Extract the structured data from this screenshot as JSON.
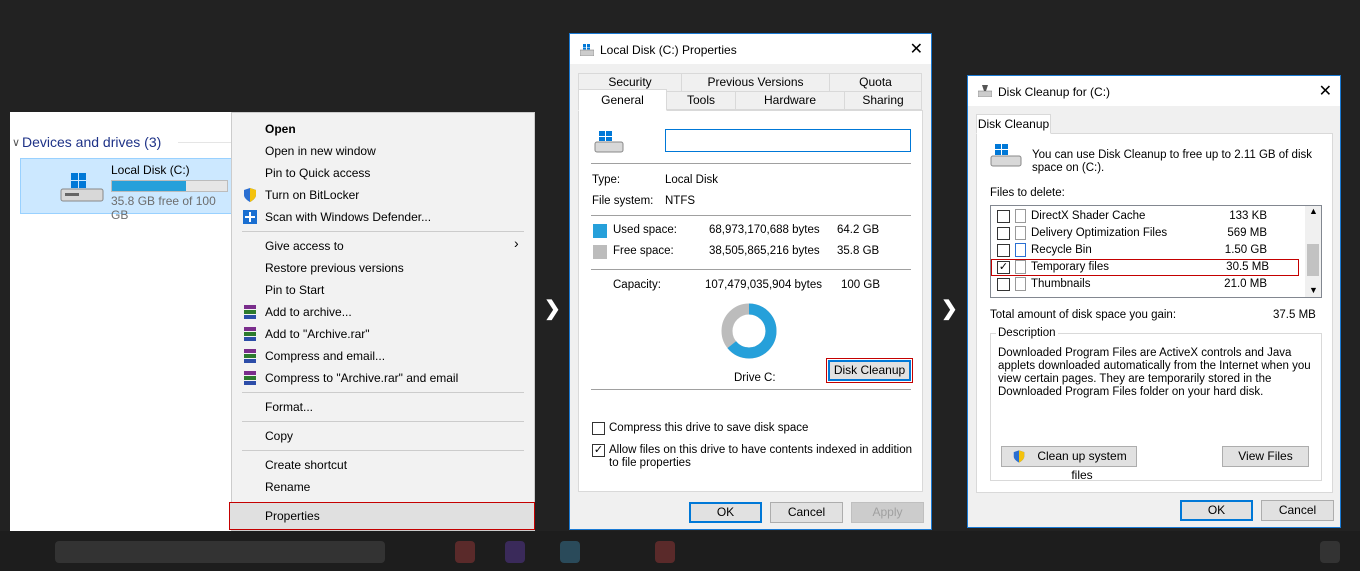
{
  "explorer": {
    "section_title": "Devices and drives (3)",
    "drive_name": "Local Disk (C:)",
    "drive_free": "35.8 GB free of 100 GB",
    "drive_used_fraction": 0.64
  },
  "context_menu": {
    "items": [
      "Open",
      "Open in new window",
      "Pin to Quick access",
      "Turn on BitLocker",
      "Scan with Windows Defender...",
      "Give access to",
      "Restore previous versions",
      "Pin to Start",
      "Add to archive...",
      "Add to \"Archive.rar\"",
      "Compress and email...",
      "Compress to \"Archive.rar\" and email",
      "Format...",
      "Copy",
      "Create shortcut",
      "Rename",
      "Properties"
    ]
  },
  "properties": {
    "title": "Local Disk (C:) Properties",
    "tabs_row1": [
      "Security",
      "Previous Versions",
      "Quota"
    ],
    "tabs_row2": [
      "General",
      "Tools",
      "Hardware",
      "Sharing"
    ],
    "name_value": "",
    "type_label": "Type:",
    "type_value": "Local Disk",
    "fs_label": "File system:",
    "fs_value": "NTFS",
    "used_label": "Used space:",
    "used_bytes": "68,973,170,688 bytes",
    "used_gb": "64.2 GB",
    "free_label": "Free space:",
    "free_bytes": "38,505,865,216 bytes",
    "free_gb": "35.8 GB",
    "capacity_label": "Capacity:",
    "capacity_bytes": "107,479,035,904 bytes",
    "capacity_gb": "100 GB",
    "used_fraction": 0.642,
    "drive_label": "Drive C:",
    "disk_cleanup_btn": "Disk Cleanup",
    "compress_label": "Compress this drive to save disk space",
    "index_label": "Allow files on this drive to have contents indexed in addition to file properties",
    "ok": "OK",
    "cancel": "Cancel",
    "apply": "Apply",
    "colors": {
      "used": "#26a0da",
      "free": "#bcbcbc"
    }
  },
  "cleanup": {
    "title": "Disk Cleanup for  (C:)",
    "tab": "Disk Cleanup",
    "intro": "You can use Disk Cleanup to free up to 2.11 GB of disk space on  (C:).",
    "files_label": "Files to delete:",
    "files": [
      {
        "name": "DirectX Shader Cache",
        "size": "133 KB",
        "checked": false
      },
      {
        "name": "Delivery Optimization Files",
        "size": "569 MB",
        "checked": false
      },
      {
        "name": "Recycle Bin",
        "size": "1.50 GB",
        "checked": false
      },
      {
        "name": "Temporary files",
        "size": "30.5 MB",
        "checked": true
      },
      {
        "name": "Thumbnails",
        "size": "21.0 MB",
        "checked": false
      }
    ],
    "total_label": "Total amount of disk space you gain:",
    "total_value": "37.5 MB",
    "desc_label": "Description",
    "desc_text": "Downloaded Program Files are ActiveX controls and Java applets downloaded automatically from the Internet when you view certain pages. They are temporarily stored in the Downloaded Program Files folder on your hard disk.",
    "clean_system_btn": "Clean up system files",
    "view_files_btn": "View Files",
    "ok": "OK",
    "cancel": "Cancel"
  }
}
